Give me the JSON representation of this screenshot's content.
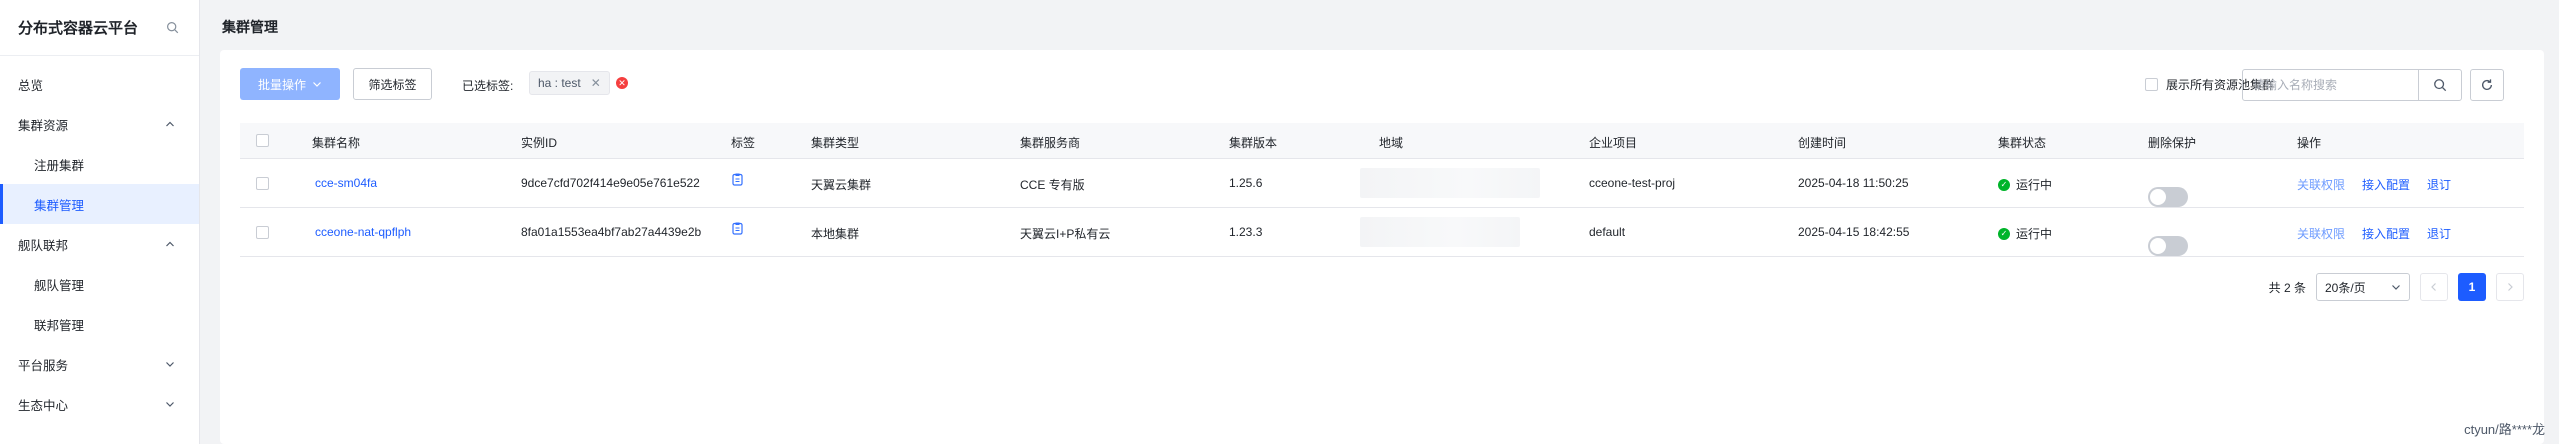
{
  "sidebar": {
    "title": "分布式容器云平台",
    "items": [
      {
        "label": "总览"
      },
      {
        "label": "集群资源"
      },
      {
        "label": "注册集群"
      },
      {
        "label": "集群管理"
      },
      {
        "label": "舰队联邦"
      },
      {
        "label": "舰队管理"
      },
      {
        "label": "联邦管理"
      },
      {
        "label": "平台服务"
      },
      {
        "label": "生态中心"
      }
    ]
  },
  "header": {
    "title": "集群管理"
  },
  "toolbar": {
    "batch_label": "批量操作",
    "filter_label": "筛选标签",
    "selected_label": "已选标签:",
    "selected_tag": "ha : test",
    "show_all_label": "展示所有资源池集群",
    "search_placeholder": "请输入名称搜索"
  },
  "table": {
    "headers": [
      "集群名称",
      "实例ID",
      "标签",
      "集群类型",
      "集群服务商",
      "集群版本",
      "地域",
      "企业项目",
      "创建时间",
      "集群状态",
      "删除保护",
      "操作"
    ],
    "rows": [
      {
        "name": "cce-sm04fa",
        "instance_id": "9dce7cfd702f414e9e05e761e522",
        "type": "天翼云集群",
        "provider": "CCE 专有版",
        "version": "1.25.6",
        "project": "cceone-test-proj",
        "created": "2025-04-18 11:50:25",
        "status": "运行中",
        "protection_on": false,
        "ops": [
          "关联权限",
          "接入配置",
          "退订"
        ]
      },
      {
        "name": "cceone-nat-qpflph",
        "instance_id": "8fa01a1553ea4bf7ab27a4439e2b",
        "type": "本地集群",
        "provider": "天翼云I+P私有云",
        "version": "1.23.3",
        "project": "default",
        "created": "2025-04-15 18:42:55",
        "status": "运行中",
        "protection_on": false,
        "ops": [
          "关联权限",
          "接入配置",
          "退订"
        ]
      }
    ]
  },
  "pagination": {
    "total": "共 2 条",
    "page_size": "20条/页",
    "current_page": "1"
  },
  "footer": {
    "user": "ctyun/路****龙"
  },
  "colors": {
    "primary": "#1d5cff",
    "success": "#00b42a",
    "danger": "#f53f3f"
  }
}
